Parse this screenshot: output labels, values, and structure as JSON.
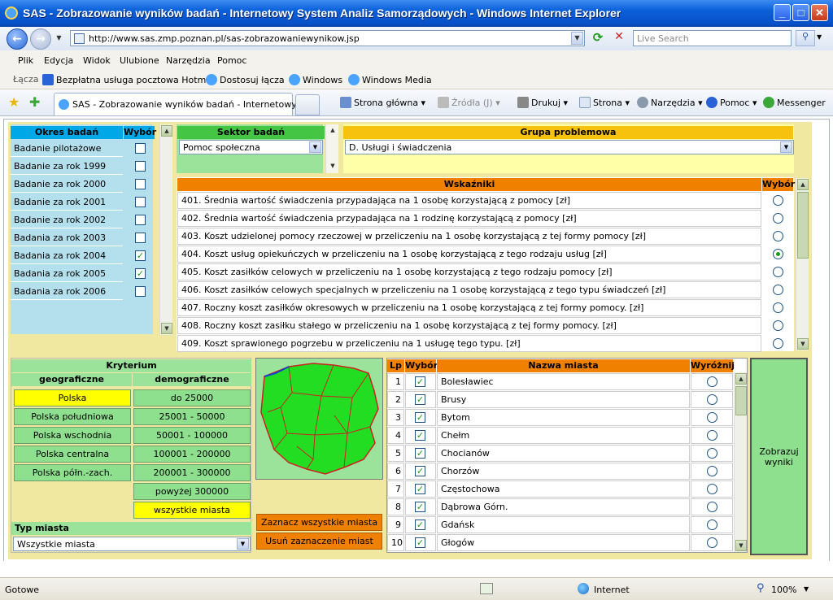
{
  "window": {
    "title": "SAS - Zobrazowanie wyników badań - Internetowy System Analiz Samorządowych - Windows Internet Explorer"
  },
  "navbar": {
    "url": "http://www.sas.zmp.poznan.pl/sas-zobrazowaniewynikow.jsp",
    "search_placeholder": "Live Search"
  },
  "menu": [
    "Plik",
    "Edycja",
    "Widok",
    "Ulubione",
    "Narzędzia",
    "Pomoc"
  ],
  "links": {
    "label": "Łącza",
    "items": [
      "Bezpłatna usługa pocztowa Hotmail",
      "Dostosuj łącza",
      "Windows",
      "Windows Media"
    ]
  },
  "tab": {
    "title": "SAS - Zobrazowanie wyników badań - Internetowy S..."
  },
  "toolbar": {
    "home": "Strona główna",
    "feeds": "Źródła (J)",
    "print": "Drukuj",
    "page": "Strona",
    "tools": "Narzędzia",
    "help": "Pomoc",
    "messenger": "Messenger"
  },
  "okres": {
    "header": "Okres badań",
    "select_header": "Wybór",
    "items": [
      {
        "label": "Badanie pilotażowe",
        "checked": false
      },
      {
        "label": "Badanie za rok 1999",
        "checked": false
      },
      {
        "label": "Badanie za rok 2000",
        "checked": false
      },
      {
        "label": "Badanie za rok 2001",
        "checked": false
      },
      {
        "label": "Badanie za rok 2002",
        "checked": false
      },
      {
        "label": "Badania za rok 2003",
        "checked": false
      },
      {
        "label": "Badania za rok 2004",
        "checked": true
      },
      {
        "label": "Badania za rok 2005",
        "checked": true
      },
      {
        "label": "Badania za rok 2006",
        "checked": false
      }
    ]
  },
  "sektor": {
    "header": "Sektor badań",
    "value": "Pomoc społeczna"
  },
  "grupa": {
    "header": "Grupa problemowa",
    "value": "D. Usługi i świadczenia"
  },
  "wskazniki": {
    "header": "Wskaźniki",
    "select_header": "Wybór",
    "items": [
      {
        "label": "401. Średnia wartość świadczenia przypadająca na 1 osobę korzystającą z pomocy [zł]",
        "selected": false
      },
      {
        "label": "402. Średnia wartość świadczenia przypadająca na 1 rodzinę korzystającą z pomocy [zł]",
        "selected": false
      },
      {
        "label": "403. Koszt udzielonej pomocy rzeczowej w przeliczeniu na 1 osobę korzystającą z tej formy pomocy [zł]",
        "selected": false
      },
      {
        "label": "404. Koszt usług opiekuńczych w przeliczeniu na 1 osobę korzystającą z tego rodzaju usług [zł]",
        "selected": true
      },
      {
        "label": "405. Koszt zasiłków celowych w przeliczeniu na 1 osobę korzystającą z tego rodzaju pomocy [zł]",
        "selected": false
      },
      {
        "label": "406. Koszt zasiłków celowych specjalnych w przeliczeniu na 1 osobę korzystającą z tego typu świadczeń [zł]",
        "selected": false
      },
      {
        "label": "407. Roczny koszt zasiłków okresowych w przeliczeniu na 1 osobę korzystającą z tej formy pomocy. [zł]",
        "selected": false
      },
      {
        "label": "408. Roczny koszt zasiłku stałego w przeliczeniu na 1 osobę korzystającą z tej formy pomocy. [zł]",
        "selected": false
      },
      {
        "label": "409. Koszt sprawionego pogrzebu w przeliczeniu na 1 usługę tego typu. [zł]",
        "selected": false
      }
    ]
  },
  "kryterium": {
    "title": "Kryterium",
    "geo_header": "geograficzne",
    "demo_header": "demograficzne",
    "geo": [
      "Polska",
      "Polska południowa",
      "Polska wschodnia",
      "Polska centralna",
      "Polska półn.-zach."
    ],
    "demo": [
      "do 25000",
      "25001 - 50000",
      "50001 - 100000",
      "100001 - 200000",
      "200001 - 300000",
      "powyżej 300000",
      "wszystkie miasta"
    ],
    "typ_label": "Typ miasta",
    "typ_value": "Wszystkie miasta"
  },
  "actions": {
    "select_all": "Zaznacz wszystkie miasta",
    "deselect_all": "Usuń zaznaczenie miast",
    "show": "Zobrazuj wyniki"
  },
  "cities": {
    "col_lp": "Lp",
    "col_select": "Wybór",
    "col_name": "Nazwa miasta",
    "col_highlight": "Wyróżnij",
    "rows": [
      {
        "lp": "1",
        "name": "Bolesławiec",
        "checked": true
      },
      {
        "lp": "2",
        "name": "Brusy",
        "checked": true
      },
      {
        "lp": "3",
        "name": "Bytom",
        "checked": true
      },
      {
        "lp": "4",
        "name": "Chełm",
        "checked": true
      },
      {
        "lp": "5",
        "name": "Chocianów",
        "checked": true
      },
      {
        "lp": "6",
        "name": "Chorzów",
        "checked": true
      },
      {
        "lp": "7",
        "name": "Częstochowa",
        "checked": true
      },
      {
        "lp": "8",
        "name": "Dąbrowa Górn.",
        "checked": true
      },
      {
        "lp": "9",
        "name": "Gdańsk",
        "checked": true
      },
      {
        "lp": "10",
        "name": "Głogów",
        "checked": true
      }
    ]
  },
  "statusbar": {
    "left": "Gotowe",
    "zone": "Internet",
    "zoom": "100%"
  },
  "colors": {
    "accent_blue": "#00a8e8",
    "accent_green": "#44c544",
    "accent_orange": "#f08000",
    "accent_yellow": "#f6c20d",
    "map_fill": "#22dd22",
    "map_border": "#cc2222"
  }
}
